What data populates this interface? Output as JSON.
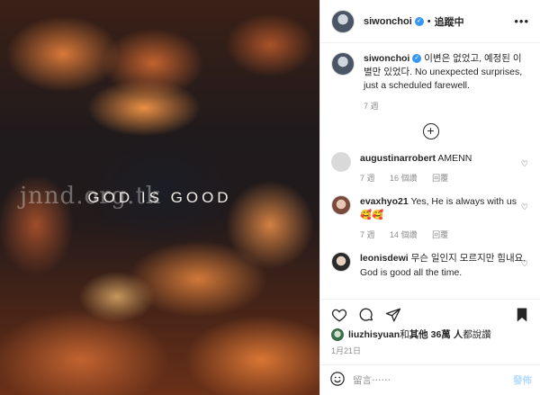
{
  "post": {
    "username": "siwonchoi",
    "follow_status": "追蹤中",
    "image_text": "GOD IS GOOD",
    "watermark": "jnnd.org.tk",
    "caption_username": "siwonchoi",
    "caption_text": "이변은 없었고, 예정된 이별만 있었다. No unexpected surprises, just a scheduled farewell.",
    "caption_age": "7 週"
  },
  "comments": [
    {
      "username": "augustinarrobert",
      "text": "AMENN",
      "age": "7 週",
      "likes": "16 個讚",
      "reply": "回覆"
    },
    {
      "username": "evaxhyo21",
      "text": "Yes, He is always with us 🥰🥰",
      "age": "7 週",
      "likes": "14 個讚",
      "reply": "回覆"
    },
    {
      "username": "leonisdewi",
      "text": "무슨 일인지 모르지만 힘내요. God is good all the time.",
      "age": "",
      "likes": "",
      "reply": ""
    }
  ],
  "likes_line": {
    "user": "liuzhisyuan",
    "middle": " 和 ",
    "others": "其他 36萬 人",
    "suffix": " 都說讚"
  },
  "date": "1月21日",
  "composer": {
    "placeholder": "留言⋯⋯",
    "post_label": "發佈"
  },
  "icons": {
    "more": "more-dots-icon",
    "add": "plus-circle-icon",
    "like": "heart-icon",
    "comment": "comment-bubble-icon",
    "share": "paper-plane-icon",
    "save": "bookmark-icon",
    "emoji": "emoji-icon"
  },
  "colors": {
    "verified": "#3897f0",
    "post_button": "#b3dbff",
    "muted": "#8e8e8e"
  }
}
